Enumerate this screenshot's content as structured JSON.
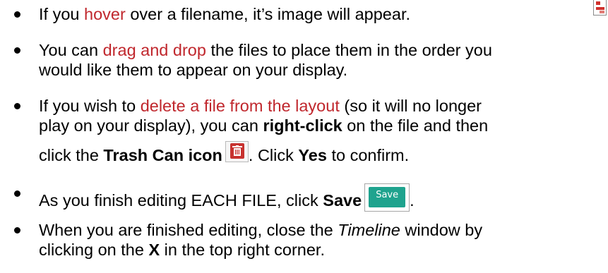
{
  "items": [
    {
      "lines": [
        [
          "If you ",
          "hover",
          " over a filename, it’s image will appear."
        ]
      ]
    },
    {
      "lines": [
        [
          "You can ",
          "drag and drop",
          " the files to place them in the order you"
        ],
        [
          "would like them to appear on your display."
        ]
      ]
    },
    {
      "lines": [
        [
          "If you wish to ",
          "delete a file from the layout",
          " (so it will no longer"
        ],
        [
          "play on your display), you can ",
          "right-click",
          " on the file and then"
        ],
        [
          "click the ",
          "Trash Can icon",
          ".  Click ",
          "Yes",
          " to confirm."
        ]
      ]
    },
    {
      "lines": [
        [
          "As you finish editing EACH FILE, click ",
          "Save",
          "."
        ]
      ]
    },
    {
      "lines": [
        [
          "When you are finished editing, close the ",
          "Timeline",
          " window by"
        ],
        [
          "clicking on the ",
          "X",
          " in the top right corner."
        ]
      ]
    }
  ],
  "save_button": {
    "label": "Save"
  },
  "icons": {
    "trash": "trash-can-icon",
    "thumbnail": "image-thumbnail-icon"
  },
  "colors": {
    "highlight": "#c0272d",
    "save_button": "#1fa38e",
    "trash_button": "#c7322f"
  }
}
